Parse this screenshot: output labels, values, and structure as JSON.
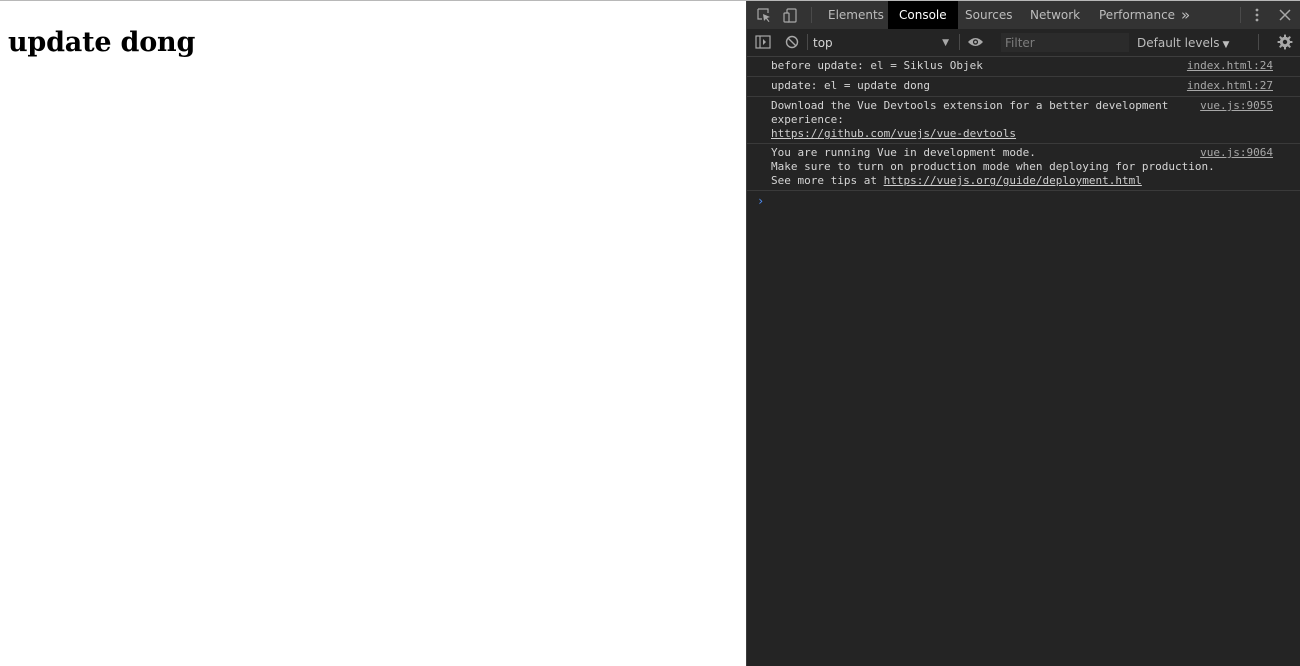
{
  "page": {
    "heading": "update dong"
  },
  "devtools": {
    "tabs": [
      {
        "label": "Elements",
        "active": false
      },
      {
        "label": "Console",
        "active": true
      },
      {
        "label": "Sources",
        "active": false
      },
      {
        "label": "Network",
        "active": false
      },
      {
        "label": "Performance",
        "active": false
      }
    ],
    "more_tabs_glyph": "»",
    "toolbar": {
      "context": "top",
      "filter_placeholder": "Filter",
      "levels_label": "Default levels"
    },
    "messages": [
      {
        "lines": [
          "before update: el = Siklus Objek"
        ],
        "source": "index.html:24"
      },
      {
        "lines": [
          "update: el = update dong"
        ],
        "source": "index.html:27"
      },
      {
        "text": "Download the Vue Devtools extension for a better development\nexperience:",
        "link": "https://github.com/vuejs/vue-devtools",
        "source": "vue.js:9055"
      },
      {
        "text": "You are running Vue in development mode.\nMake sure to turn on production mode when deploying for production.\nSee more tips at ",
        "link": "https://vuejs.org/guide/deployment.html",
        "source": "vue.js:9064"
      }
    ],
    "prompt_glyph": "›",
    "colors": {
      "panel_bg": "#242424",
      "tabbar_bg": "#333333",
      "active_tab_bg": "#000000",
      "prompt": "#4e8df5"
    }
  }
}
